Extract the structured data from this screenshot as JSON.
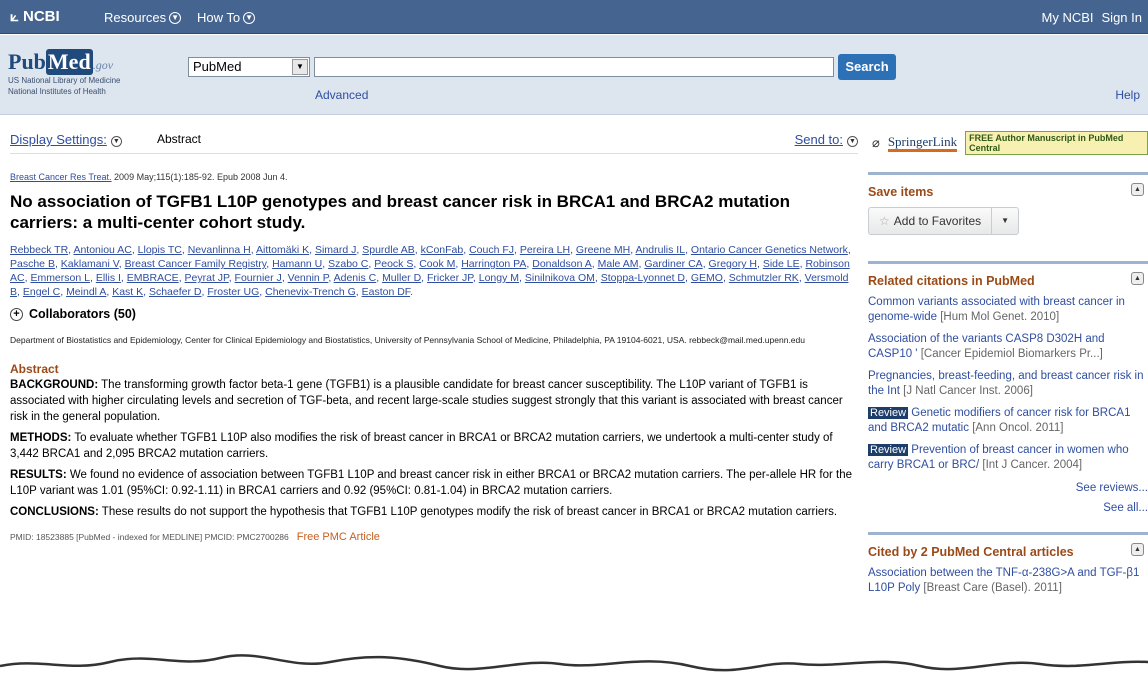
{
  "topbar": {
    "logo": "NCBI",
    "resources": "Resources",
    "howto": "How To",
    "my_ncbi": "My NCBI",
    "sign_in": "Sign In"
  },
  "header": {
    "logo_pub": "Pub",
    "logo_med": "Med",
    "logo_gov": ".gov",
    "logo_sub1": "US National Library of Medicine",
    "logo_sub2": "National Institutes of Health",
    "db_value": "PubMed",
    "search_value": "",
    "search_button": "Search",
    "advanced": "Advanced",
    "help": "Help"
  },
  "main": {
    "display_settings": "Display Settings:",
    "format": "Abstract",
    "send_to": "Send to:",
    "citation_journal": "Breast Cancer Res Treat.",
    "citation_rest": " 2009 May;115(1):185-92. Epub 2008 Jun 4.",
    "title": "No association of TGFB1 L10P genotypes and breast cancer risk in BRCA1 and BRCA2 mutation carriers: a multi-center cohort study.",
    "authors": [
      "Rebbeck TR",
      "Antoniou AC",
      "Llopis TC",
      "Nevanlinna H",
      "Aittomäki K",
      "Simard J",
      "Spurdle AB",
      "kConFab",
      "Couch FJ",
      "Pereira LH",
      "Greene MH",
      "Andrulis IL",
      "Ontario Cancer Genetics Network",
      "Pasche B",
      "Kaklamani V",
      "Breast Cancer Family Registry",
      "Hamann U",
      "Szabo C",
      "Peock S",
      "Cook M",
      "Harrington PA",
      "Donaldson A",
      "Male AM",
      "Gardiner CA",
      "Gregory H",
      "Side LE",
      "Robinson AC",
      "Emmerson L",
      "Ellis I",
      "EMBRACE",
      "Peyrat JP",
      "Fournier J",
      "Vennin P",
      "Adenis C",
      "Muller D",
      "Fricker JP",
      "Longy M",
      "Sinilnikova OM",
      "Stoppa-Lyonnet D",
      "GEMO",
      "Schmutzler RK",
      "Versmold B",
      "Engel C",
      "Meindl A",
      "Kast K",
      "Schaefer D",
      "Froster UG",
      "Chenevix-Trench G",
      "Easton DF"
    ],
    "collaborators": "Collaborators (50)",
    "affiliation": "Department of Biostatistics and Epidemiology, Center for Clinical Epidemiology and Biostatistics, University of Pennsylvania School of Medicine, Philadelphia, PA 19104-6021, USA. rebbeck@mail.med.upenn.edu",
    "abstract_heading": "Abstract",
    "sections": [
      {
        "label": "BACKGROUND:",
        "text": " The transforming growth factor beta-1 gene (TGFB1) is a plausible candidate for breast cancer susceptibility. The L10P variant of TGFB1 is associated with higher circulating levels and secretion of TGF-beta, and recent large-scale studies suggest strongly that this variant is associated with breast cancer risk in the general population."
      },
      {
        "label": "METHODS:",
        "text": " To evaluate whether TGFB1 L10P also modifies the risk of breast cancer in BRCA1 or BRCA2 mutation carriers, we undertook a multi-center study of 3,442 BRCA1 and 2,095 BRCA2 mutation carriers."
      },
      {
        "label": "RESULTS:",
        "text": " We found no evidence of association between TGFB1 L10P and breast cancer risk in either BRCA1 or BRCA2 mutation carriers. The per-allele HR for the L10P variant was 1.01 (95%CI: 0.92-1.11) in BRCA1 carriers and 0.92 (95%CI: 0.81-1.04) in BRCA2 mutation carriers."
      },
      {
        "label": "CONCLUSIONS:",
        "text": " These results do not support the hypothesis that TGFB1 L10P genotypes modify the risk of breast cancer in BRCA1 or BRCA2 mutation carriers."
      }
    ],
    "pmid_line": "PMID: 18523885 [PubMed - indexed for MEDLINE]   PMCID: PMC2700286",
    "free_pmc": "Free PMC Article"
  },
  "sidebar": {
    "springer": "SpringerLink",
    "free_badge": "FREE Author Manuscript in PubMed Central",
    "save_items": "Save items",
    "add_favorites": "Add to Favorites",
    "related_heading": "Related citations in PubMed",
    "related": [
      {
        "review": "",
        "text": "Common variants associated with breast cancer in genome-wide",
        "src": " [Hum Mol Genet. 2010]"
      },
      {
        "review": "",
        "text": "Association of the variants CASP8 D302H and CASP10 '",
        "src": " [Cancer Epidemiol Biomarkers Pr...]"
      },
      {
        "review": "",
        "text": "Pregnancies, breast-feeding, and breast cancer risk in the Int",
        "src": " [J Natl Cancer Inst. 2006]"
      },
      {
        "review": "Review",
        "text": " Genetic modifiers of cancer risk for BRCA1 and BRCA2 mutatic",
        "src": " [Ann Oncol. 2011]"
      },
      {
        "review": "Review",
        "text": " Prevention of breast cancer in women who carry BRCA1 or BRC/",
        "src": " [Int J Cancer. 2004]"
      }
    ],
    "see_reviews": "See reviews...",
    "see_all": "See all...",
    "cited_heading": "Cited by 2 PubMed Central articles",
    "cited": [
      {
        "text": "Association between the TNF-α-238G>A and TGF-β1 L10P Poly",
        "src": " [Breast Care (Basel). 2011]"
      }
    ]
  }
}
